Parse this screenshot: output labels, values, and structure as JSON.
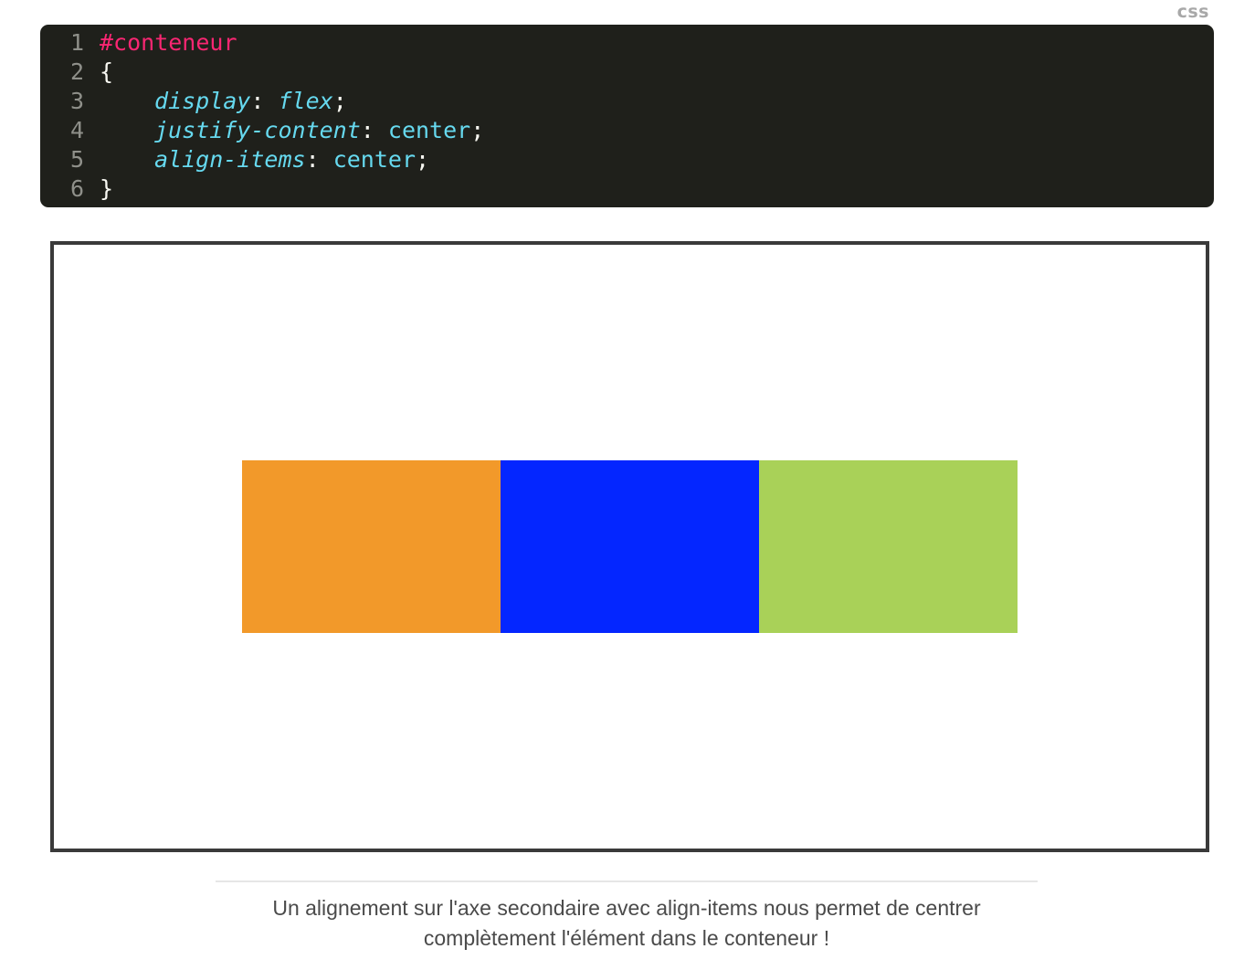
{
  "code_block": {
    "language_label": "css",
    "lines": [
      {
        "number": "1",
        "selector": "#conteneur"
      },
      {
        "number": "2",
        "punct": "{"
      },
      {
        "number": "3",
        "property": "display",
        "colon": ":",
        "value": "flex",
        "semi": ";"
      },
      {
        "number": "4",
        "property": "justify-content",
        "colon": ":",
        "value": "center",
        "semi": ";"
      },
      {
        "number": "5",
        "property": "align-items",
        "colon": ":",
        "value": "center",
        "semi": ";"
      },
      {
        "number": "6",
        "punct": "}"
      }
    ]
  },
  "demo": {
    "items": [
      {
        "color": "#f2992a"
      },
      {
        "color": "#0426ff"
      },
      {
        "color": "#a9d158"
      }
    ]
  },
  "caption": {
    "text": "Un alignement sur l'axe secondaire avec align-items nous permet de centrer complètement l'élément dans le conteneur !"
  }
}
